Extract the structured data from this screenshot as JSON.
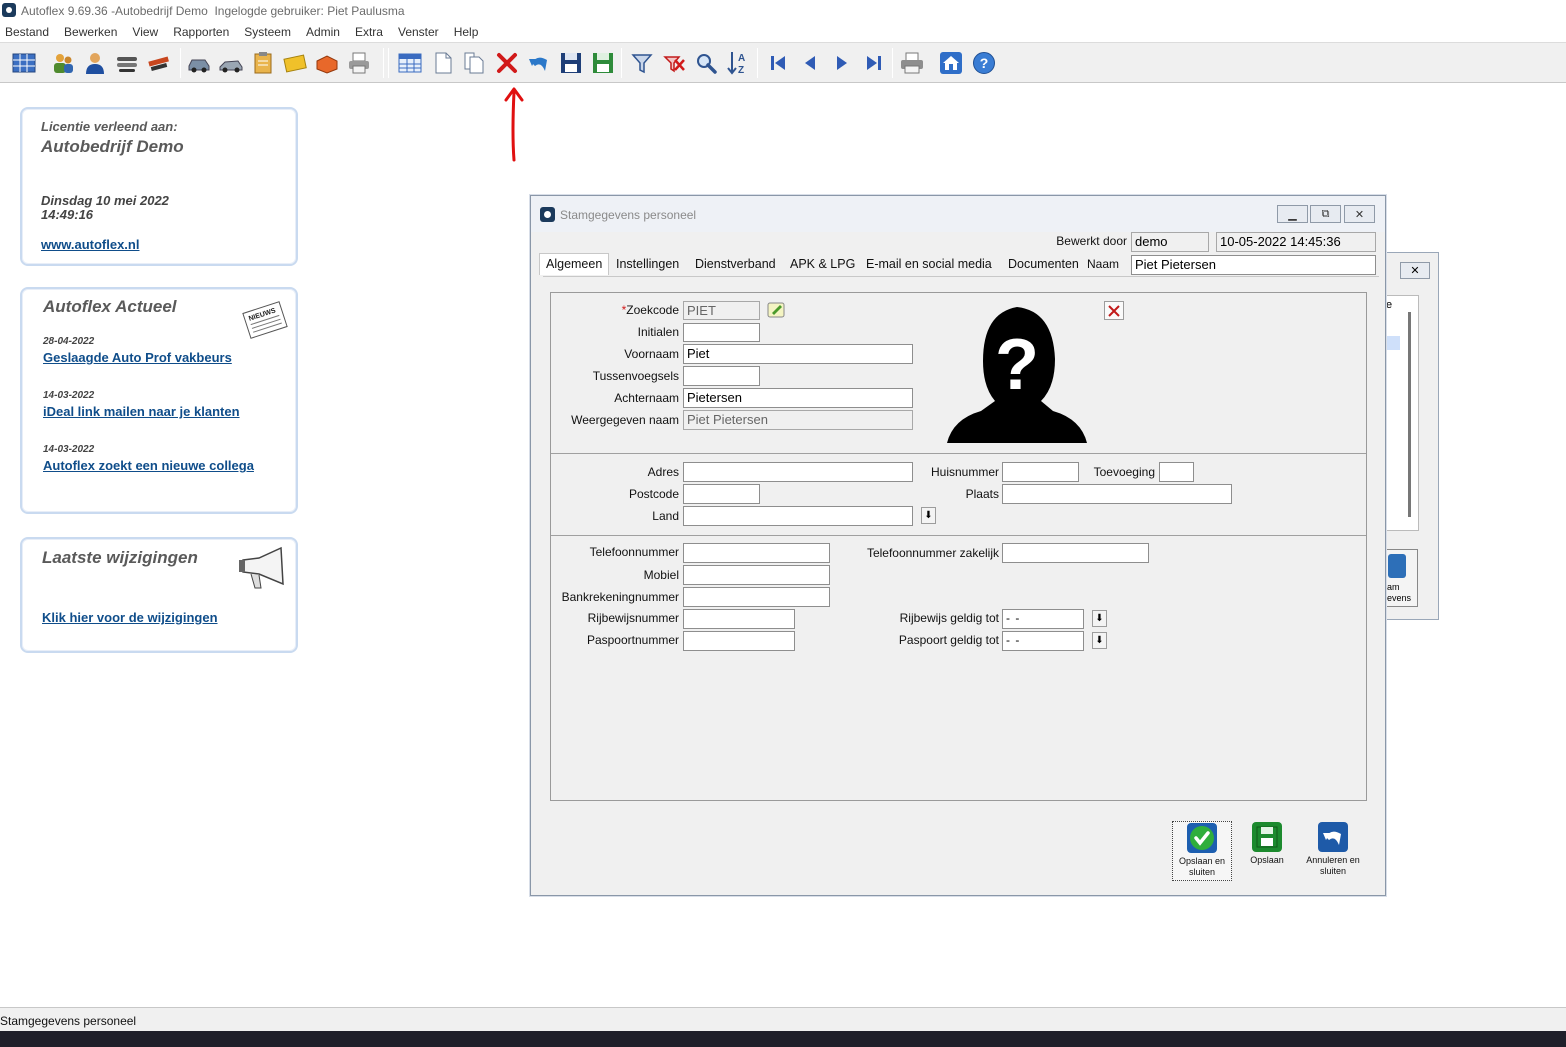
{
  "window": {
    "title": "Autoflex 9.69.36 -Autobedrijf Demo  Ingelogde gebruiker: Piet Paulusma"
  },
  "menu": [
    "Bestand",
    "Bewerken",
    "View",
    "Rapporten",
    "Systeem",
    "Admin",
    "Extra",
    "Venster",
    "Help"
  ],
  "toolbar_icons": [
    "grid-icon",
    "users-icon",
    "person-icon",
    "keys-icon",
    "tools-icon",
    "car-icon",
    "truck-icon",
    "clipboard-icon",
    "envelope-icon",
    "box-icon",
    "printer-icon",
    "table-icon",
    "new-document-icon",
    "copy-document-icon",
    "delete-icon",
    "undo-icon",
    "save-icon",
    "save-green-icon",
    "filter-icon",
    "remove-filter-icon",
    "search-icon",
    "sort-az-icon",
    "first-record-icon",
    "previous-record-icon",
    "next-record-icon",
    "last-record-icon",
    "print-icon",
    "home-icon",
    "help-icon"
  ],
  "license_panel": {
    "heading": "Licentie verleend aan:",
    "company": "Autobedrijf Demo",
    "date": "Dinsdag 10 mei 2022",
    "time": "14:49:16",
    "link": "www.autoflex.nl"
  },
  "news_panel": {
    "title": "Autoflex Actueel",
    "badge": "NIEUWS",
    "items": [
      {
        "date": "28-04-2022",
        "title": "Geslaagde Auto Prof vakbeurs"
      },
      {
        "date": "14-03-2022",
        "title": "iDeal link mailen naar je klanten"
      },
      {
        "date": "14-03-2022",
        "title": "Autoflex zoekt een nieuwe collega"
      }
    ]
  },
  "changes_panel": {
    "title": "Laatste wijzigingen",
    "link": "Klik hier voor de wijzigingen"
  },
  "dialog": {
    "title": "Stamgegevens personeel",
    "edited_by_label": "Bewerkt door",
    "edited_by_value": "demo",
    "edited_timestamp": "10-05-2022 14:45:36",
    "name_label": "Naam",
    "name_value": "Piet Pietersen",
    "tabs": [
      "Algemeen",
      "Instellingen",
      "Dienstverband",
      "APK & LPG",
      "E-mail en social media",
      "Documenten"
    ],
    "active_tab": "Algemeen",
    "fields": {
      "zoekcode": {
        "label": "*Zoekcode",
        "value": "PIET"
      },
      "initialen": {
        "label": "Initialen",
        "value": ""
      },
      "voornaam": {
        "label": "Voornaam",
        "value": "Piet"
      },
      "tussenvoegsels": {
        "label": "Tussenvoegsels",
        "value": ""
      },
      "achternaam": {
        "label": "Achternaam",
        "value": "Pietersen"
      },
      "weergegeven_naam": {
        "label": "Weergegeven naam",
        "value": "Piet Pietersen"
      },
      "adres": {
        "label": "Adres",
        "value": ""
      },
      "huisnummer": {
        "label": "Huisnummer",
        "value": ""
      },
      "toevoeging": {
        "label": "Toevoeging",
        "value": ""
      },
      "postcode": {
        "label": "Postcode",
        "value": ""
      },
      "plaats": {
        "label": "Plaats",
        "value": ""
      },
      "land": {
        "label": "Land",
        "value": ""
      },
      "telefoonnummer": {
        "label": "Telefoonnummer",
        "value": ""
      },
      "telefoonnummer_zakelijk": {
        "label": "Telefoonnummer zakelijk",
        "value": ""
      },
      "mobiel": {
        "label": "Mobiel",
        "value": ""
      },
      "bankrekeningnummer": {
        "label": "Bankrekeningnummer",
        "value": ""
      },
      "rijbewijsnummer": {
        "label": "Rijbewijsnummer",
        "value": ""
      },
      "rijbewijs_geldig_tot": {
        "label": "Rijbewijs geldig tot",
        "value": "-  -"
      },
      "paspoortnummer": {
        "label": "Paspoortnummer",
        "value": ""
      },
      "paspoort_geldig_tot": {
        "label": "Paspoort geldig tot",
        "value": "-  -"
      }
    },
    "buttons": {
      "save_close": "Opslaan en sluiten",
      "save": "Opslaan",
      "cancel_close": "Annuleren en sluiten"
    }
  },
  "background_window": {
    "fragment_text_1": "e",
    "fragment_text_2": "am",
    "fragment_text_3": "evens"
  },
  "statusbar": {
    "text": "Stamgegevens personeel"
  },
  "colors": {
    "link": "#0f4d8a",
    "panel_border": "#c9daf0",
    "delete_red": "#d11a1a",
    "arrow_red": "#e01010",
    "save_green": "#1c8a2e",
    "cancel_blue": "#1e5aa8"
  }
}
